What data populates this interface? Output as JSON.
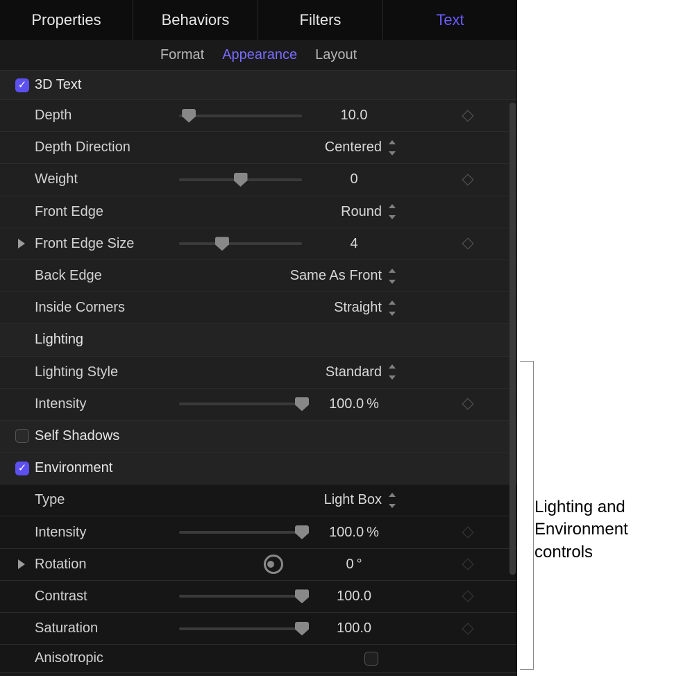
{
  "main_tabs": {
    "properties": "Properties",
    "behaviors": "Behaviors",
    "filters": "Filters",
    "text": "Text"
  },
  "sub_tabs": {
    "format": "Format",
    "appearance": "Appearance",
    "layout": "Layout"
  },
  "section_3d": {
    "title": "3D Text",
    "checked": true,
    "depth": {
      "label": "Depth",
      "value": "10.0",
      "pos": 8
    },
    "depth_direction": {
      "label": "Depth Direction",
      "value": "Centered"
    },
    "weight": {
      "label": "Weight",
      "value": "0",
      "pos": 50
    },
    "front_edge": {
      "label": "Front Edge",
      "value": "Round"
    },
    "front_edge_size": {
      "label": "Front Edge Size",
      "value": "4",
      "pos": 35
    },
    "back_edge": {
      "label": "Back Edge",
      "value": "Same As Front"
    },
    "inside_corners": {
      "label": "Inside Corners",
      "value": "Straight"
    }
  },
  "lighting": {
    "title": "Lighting",
    "style": {
      "label": "Lighting Style",
      "value": "Standard"
    },
    "intensity": {
      "label": "Intensity",
      "value": "100.0",
      "unit": "%",
      "pos": 100
    }
  },
  "self_shadows": {
    "label": "Self Shadows",
    "checked": false
  },
  "environment": {
    "title": "Environment",
    "checked": true,
    "type": {
      "label": "Type",
      "value": "Light Box"
    },
    "intensity": {
      "label": "Intensity",
      "value": "100.0",
      "unit": "%",
      "pos": 100
    },
    "rotation": {
      "label": "Rotation",
      "value": "0",
      "unit": "°"
    },
    "contrast": {
      "label": "Contrast",
      "value": "100.0",
      "pos": 100
    },
    "saturation": {
      "label": "Saturation",
      "value": "100.0",
      "pos": 100
    },
    "anisotropic": {
      "label": "Anisotropic",
      "checked": false
    }
  },
  "callout": "Lighting and\nEnvironment\ncontrols"
}
